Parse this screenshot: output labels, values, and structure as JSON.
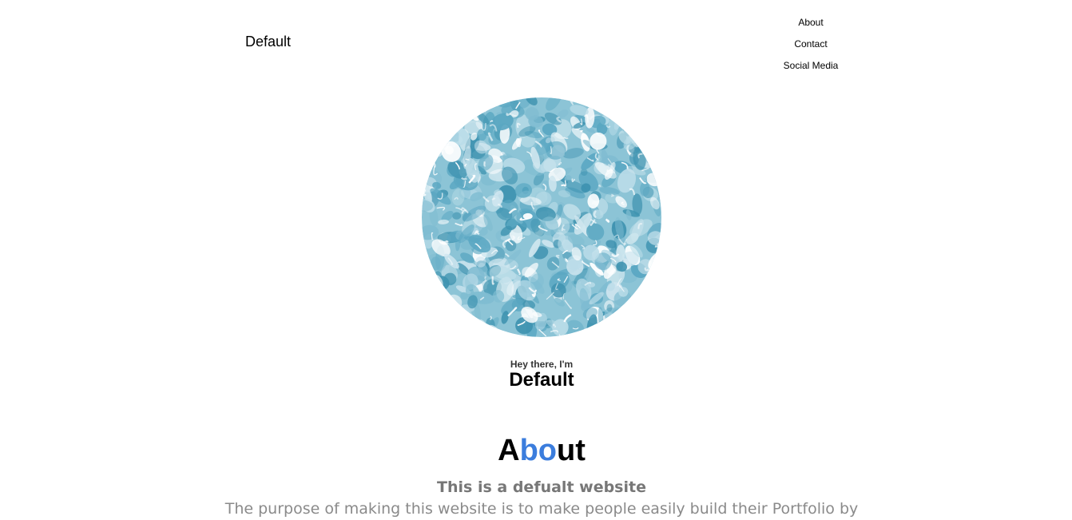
{
  "header": {
    "brand": "Default",
    "nav": [
      {
        "label": "About"
      },
      {
        "label": "Contact"
      },
      {
        "label": "Social Media"
      }
    ]
  },
  "hero": {
    "image": "water-ripple-photo",
    "greeting": "Hey there, I'm",
    "name": "Default"
  },
  "about": {
    "title_parts": [
      "A",
      "bo",
      "ut"
    ],
    "subtitle": "This is a defualt website",
    "text": "The purpose of making this website is to make people easily build their Portfolio by"
  },
  "colors": {
    "accent": "#3b7ddd",
    "water_light": "#cfe6ef",
    "water_mid": "#7fbcd1",
    "water_dark": "#3f93b0"
  }
}
